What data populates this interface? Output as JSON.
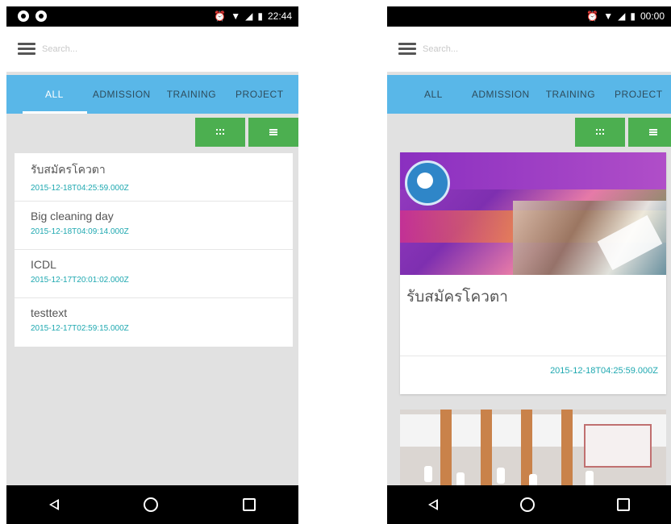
{
  "left_phone": {
    "status": {
      "time": "22:44"
    },
    "search": {
      "placeholder": "Search..."
    },
    "tabs": [
      {
        "label": "ALL",
        "active": true
      },
      {
        "label": "ADMISSION",
        "active": false
      },
      {
        "label": "TRAINING",
        "active": false
      },
      {
        "label": "PROJECT",
        "active": false
      }
    ],
    "items": [
      {
        "title": "รับสมัครโควตา",
        "date": "2015-12-18T04:25:59.000Z"
      },
      {
        "title": "Big cleaning day",
        "date": "2015-12-18T04:09:14.000Z"
      },
      {
        "title": "ICDL",
        "date": "2015-12-17T20:01:02.000Z"
      },
      {
        "title": "testtext",
        "date": "2015-12-17T02:59:15.000Z"
      }
    ]
  },
  "right_phone": {
    "status": {
      "time": "00:00"
    },
    "search": {
      "placeholder": "Search..."
    },
    "tabs": [
      {
        "label": "ALL",
        "active": false
      },
      {
        "label": "ADMISSION",
        "active": false
      },
      {
        "label": "TRAINING",
        "active": false
      },
      {
        "label": "PROJECT",
        "active": false
      }
    ],
    "cards": [
      {
        "title": "รับสมัครโควตา",
        "date": "2015-12-18T04:25:59.000Z"
      }
    ]
  },
  "colors": {
    "tab_bar": "#59b7e8",
    "toggle_green": "#4caf50",
    "date_teal": "#1ea8b0",
    "background_gray": "#e1e1e1"
  },
  "icons": {
    "toggle_grid": "grid-view-icon",
    "toggle_list": "list-view-icon",
    "menu": "hamburger-menu-icon",
    "nav_back": "back-triangle-icon",
    "nav_home": "home-circle-icon",
    "nav_recent": "recent-square-icon"
  }
}
